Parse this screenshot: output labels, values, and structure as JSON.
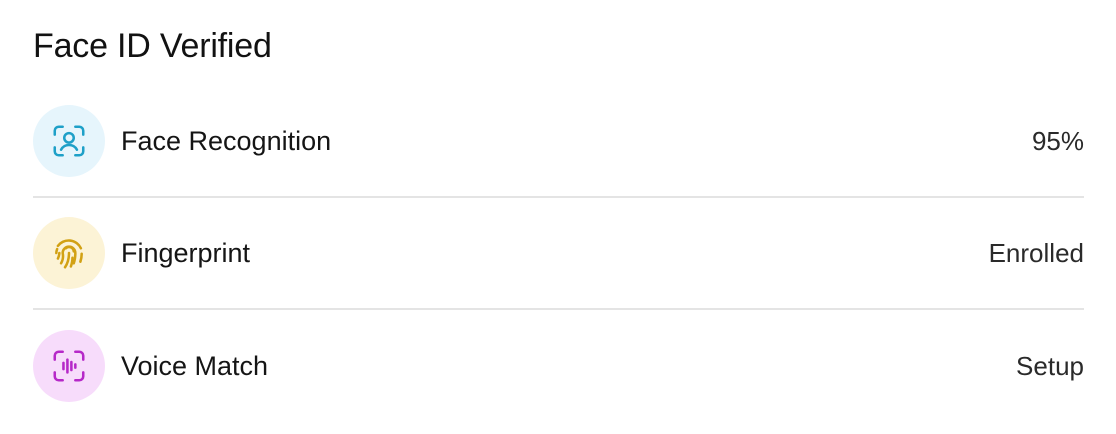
{
  "header": {
    "title": "Face ID Verified"
  },
  "items": [
    {
      "label": "Face Recognition",
      "value": "95%",
      "icon": "face-scan-icon",
      "icon_color": "#1ea0c8",
      "icon_bg": "#e6f5fc"
    },
    {
      "label": "Fingerprint",
      "value": "Enrolled",
      "icon": "fingerprint-icon",
      "icon_color": "#d2a114",
      "icon_bg": "#fcf3d6"
    },
    {
      "label": "Voice Match",
      "value": "Setup",
      "icon": "voice-scan-icon",
      "icon_color": "#b628c8",
      "icon_bg": "#f7dcfb"
    }
  ]
}
